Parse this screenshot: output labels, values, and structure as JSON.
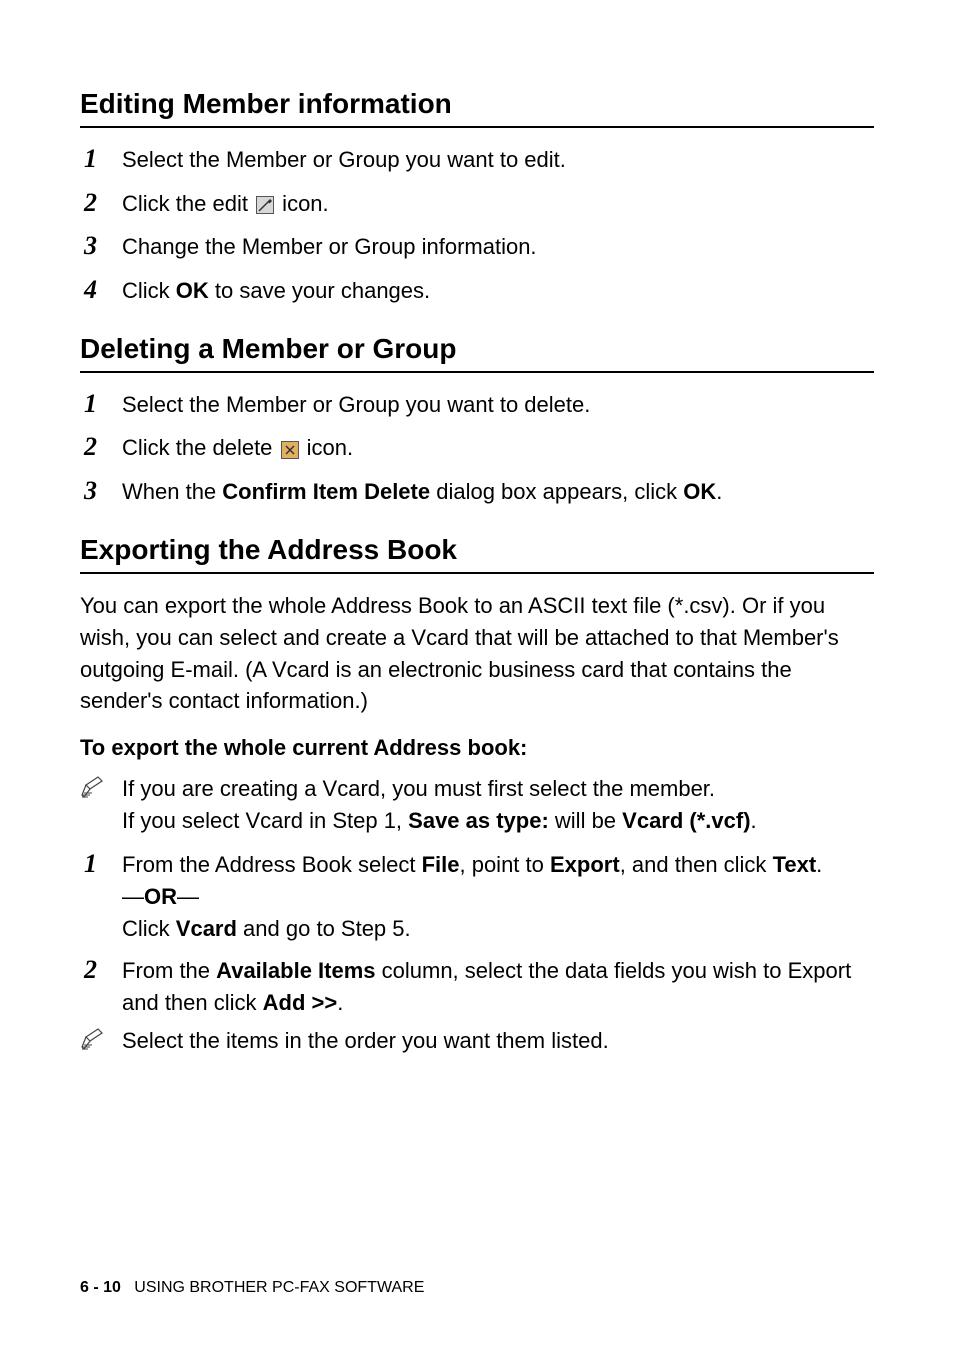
{
  "sections": {
    "editing": {
      "heading": "Editing Member information",
      "steps": [
        {
          "n": "1",
          "text_html": "Select the Member or Group you want to edit."
        },
        {
          "n": "2",
          "before": "Click the edit ",
          "after": " icon.",
          "icon": "edit"
        },
        {
          "n": "3",
          "text_html": "Change the Member or Group information."
        },
        {
          "n": "4",
          "text_html": "Click <b>OK</b> to save your changes."
        }
      ]
    },
    "deleting": {
      "heading": "Deleting a Member or Group",
      "steps": [
        {
          "n": "1",
          "text_html": "Select the Member or Group you want to delete."
        },
        {
          "n": "2",
          "before": "Click the delete ",
          "after": " icon.",
          "icon": "delete"
        },
        {
          "n": "3",
          "text_html": "When the <b>Confirm Item Delete</b> dialog box appears, click <b>OK</b>."
        }
      ]
    },
    "exporting": {
      "heading": "Exporting the Address Book",
      "intro": "You can export the whole Address Book to an ASCII text file (*.csv). Or if you wish, you can select and create a Vcard that will be attached to that Member's outgoing E-mail. (A Vcard is an electronic business card that contains the sender's contact information.)",
      "subheading": "To export the whole current Address book:",
      "note1_line1": "If you are creating a Vcard, you must first select the member.",
      "note1_line2_html": "If you select Vcard in Step 1, <b>Save as type:</b> will be <b>Vcard (*.vcf)</b>.",
      "steps": [
        {
          "n": "1",
          "text_html": "From the Address Book select <b>File</b>, point to <b>Export</b>, and then click <b>Text</b>.<br>—<b>OR</b>—<br>Click <b>Vcard</b> and go to Step 5."
        },
        {
          "n": "2",
          "text_html": "From the <b>Available Items</b> column, select the data fields you wish to Export and then click <b>Add &gt;&gt;</b>."
        }
      ],
      "note2": "Select the items in the order you want them listed."
    }
  },
  "footer": {
    "pagenum": "6 - 10",
    "title": "USING BROTHER PC-FAX SOFTWARE"
  }
}
